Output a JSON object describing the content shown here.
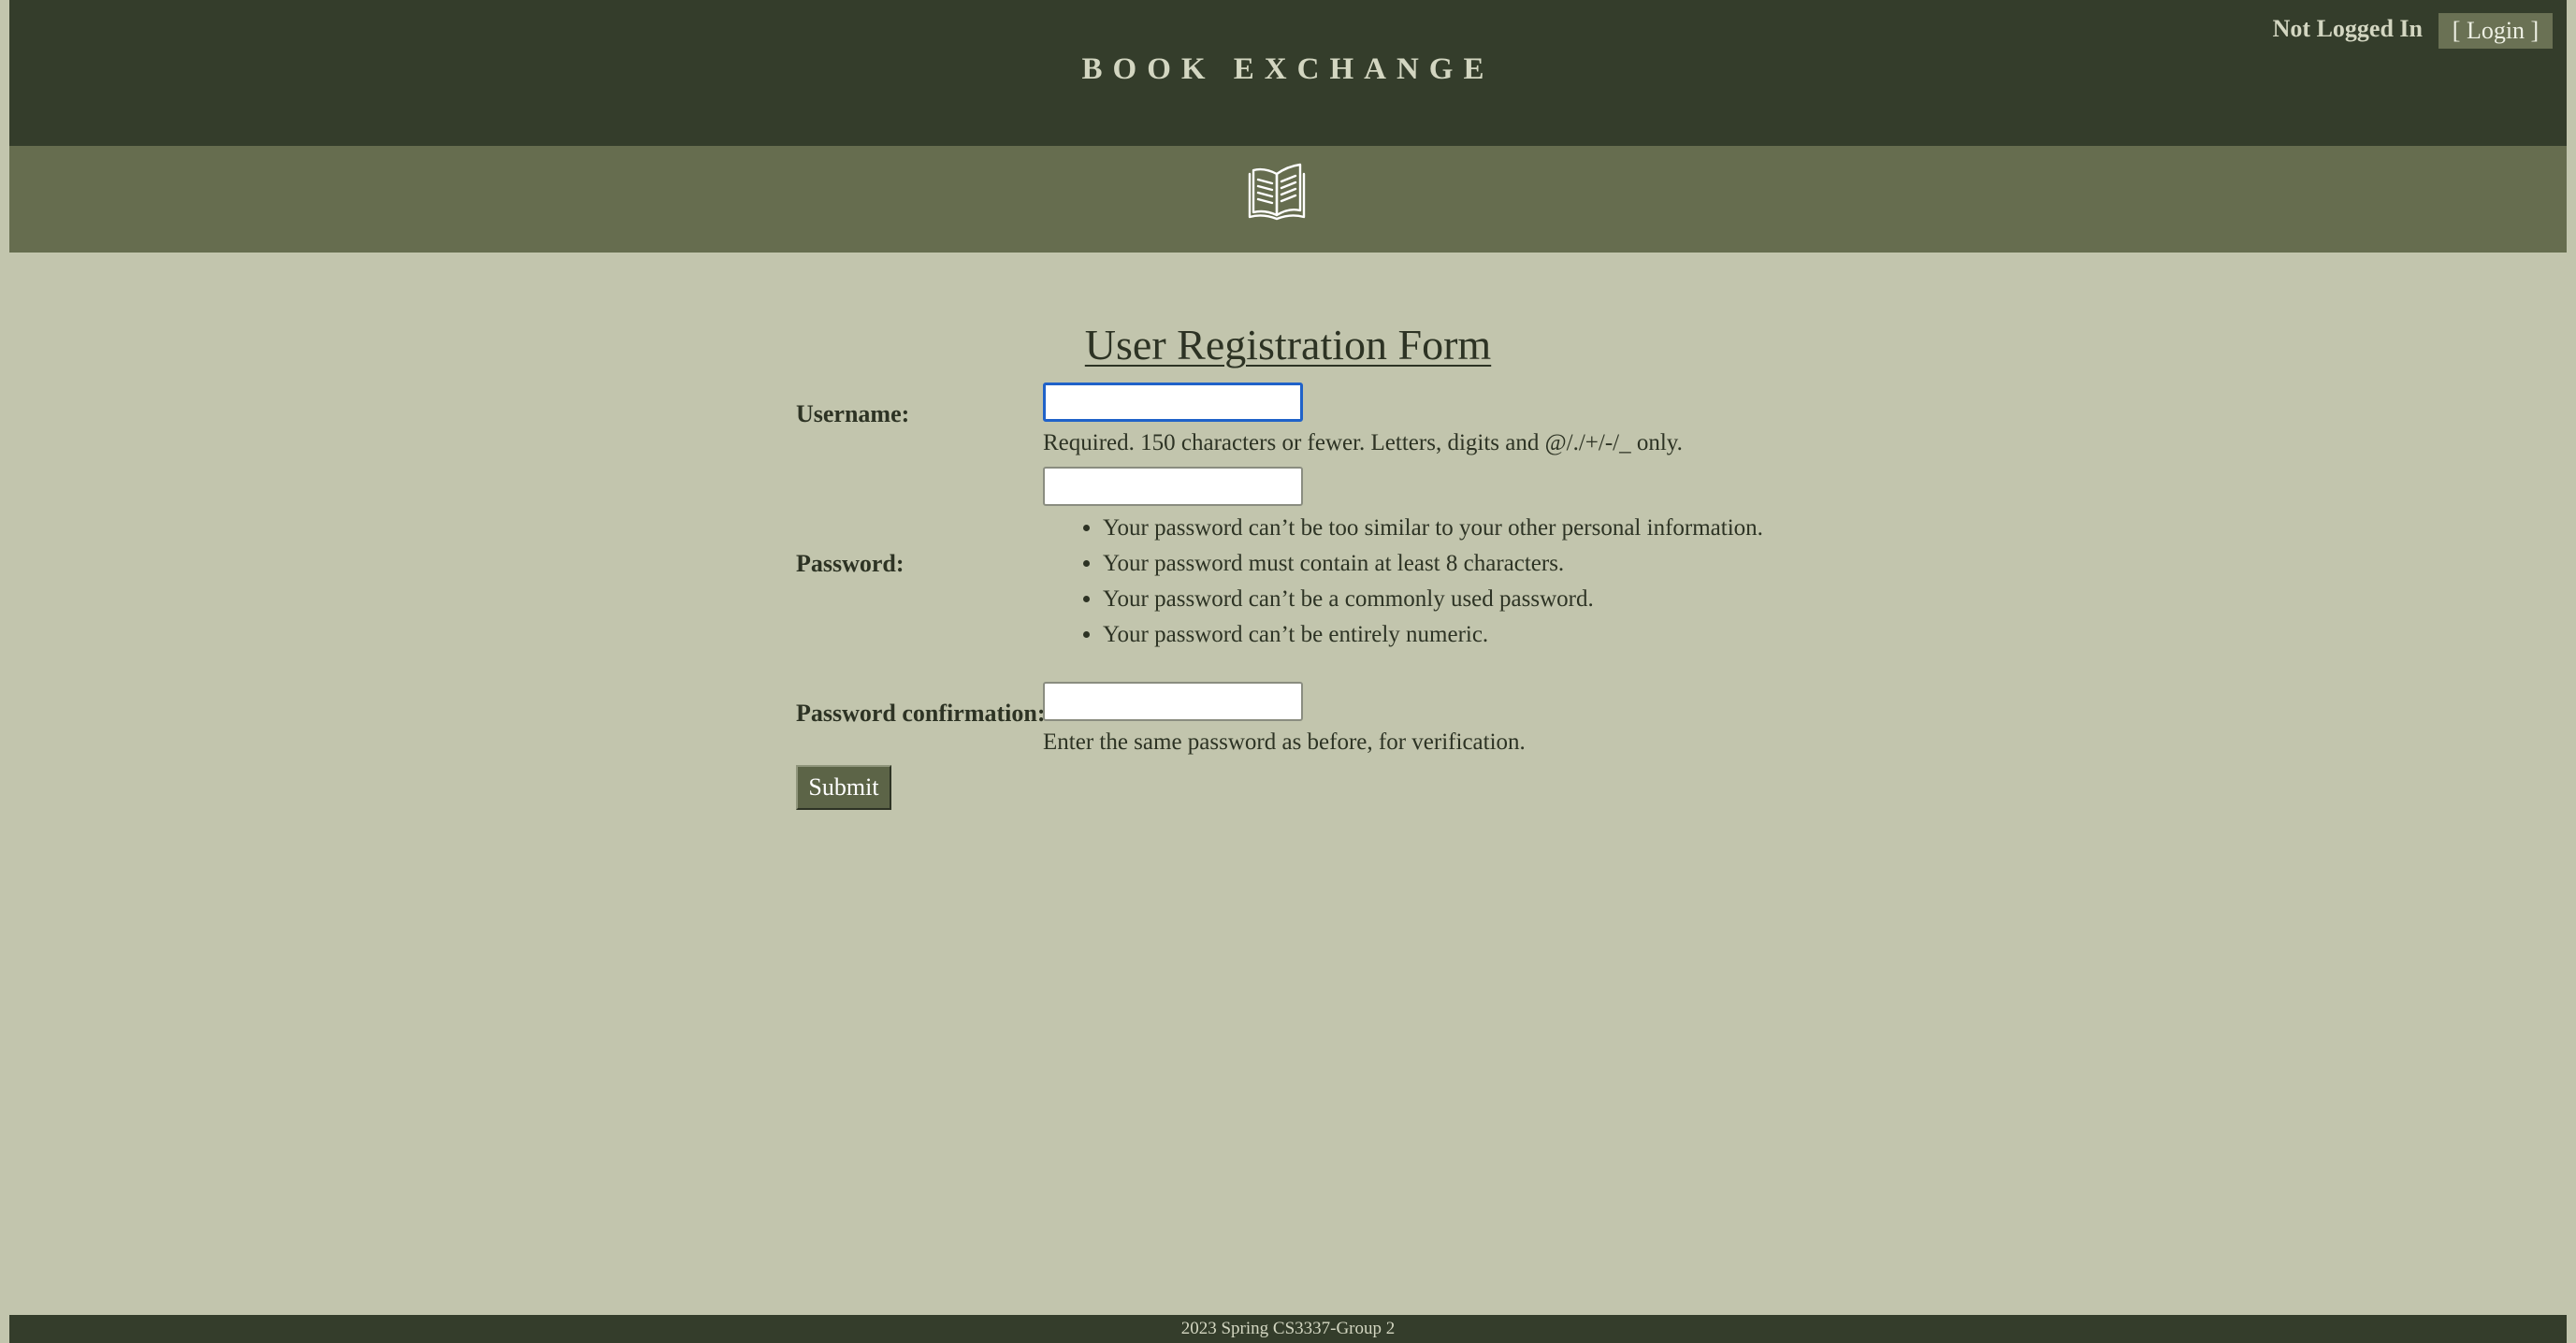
{
  "header": {
    "site_title": "BOOK EXCHANGE",
    "auth_status": "Not Logged In",
    "login_label": "[ Login ]"
  },
  "banner": {
    "icon": "open-book-icon"
  },
  "form": {
    "title": "User Registration Form",
    "username": {
      "label": "Username:",
      "value": "",
      "help": "Required. 150 characters or fewer. Letters, digits and @/./+/-/_ only."
    },
    "password": {
      "label": "Password:",
      "value": "",
      "rules": [
        "Your password can’t be too similar to your other personal information.",
        "Your password must contain at least 8 characters.",
        "Your password can’t be a commonly used password.",
        "Your password can’t be entirely numeric."
      ]
    },
    "password_confirmation": {
      "label": "Password confirmation:",
      "value": "",
      "help": "Enter the same password as before, for verification."
    },
    "submit_label": "Submit"
  },
  "footer": {
    "text": "2023 Spring CS3337-Group 2"
  },
  "colors": {
    "header_bg": "#343d2b",
    "banner_bg": "#666d4f",
    "page_bg": "#c2c5ad",
    "focus_ring": "#1f62c9"
  }
}
